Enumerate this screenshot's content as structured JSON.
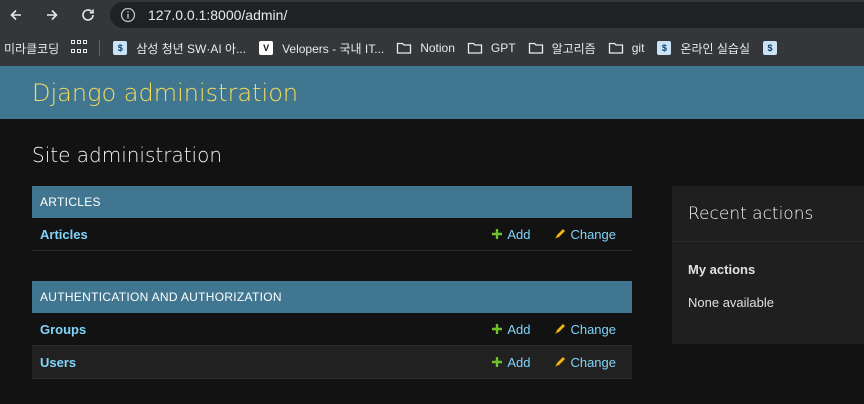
{
  "browser": {
    "url": "127.0.0.1:8000/admin/",
    "bookmarks": [
      {
        "label": "미라클코딩",
        "icon": "none"
      },
      {
        "label": "",
        "icon": "apps-grid-icon"
      },
      {
        "label": "삼성 청년 SW·AI 아...",
        "icon": "ssafy-favicon"
      },
      {
        "label": "Velopers - 국내 IT...",
        "icon": "velopers-favicon"
      },
      {
        "label": "Notion",
        "icon": "folder-icon"
      },
      {
        "label": "GPT",
        "icon": "folder-icon"
      },
      {
        "label": "알고리즘",
        "icon": "folder-icon"
      },
      {
        "label": "git",
        "icon": "folder-icon"
      },
      {
        "label": "온라인 실습실",
        "icon": "ssafy-favicon"
      }
    ]
  },
  "header": {
    "brand": "Django administration"
  },
  "page": {
    "title": "Site administration"
  },
  "modules": [
    {
      "caption": "ARTICLES",
      "models": [
        {
          "name": "Articles",
          "add_label": "Add",
          "change_label": "Change"
        }
      ]
    },
    {
      "caption": "AUTHENTICATION AND AUTHORIZATION",
      "models": [
        {
          "name": "Groups",
          "add_label": "Add",
          "change_label": "Change"
        },
        {
          "name": "Users",
          "add_label": "Add",
          "change_label": "Change"
        }
      ]
    }
  ],
  "recent_actions": {
    "title": "Recent actions",
    "subtitle": "My actions",
    "empty_text": "None available"
  },
  "colors": {
    "header_bg": "#417690",
    "brand": "#f5dd5d",
    "link": "#81d4fa",
    "add_icon": "#70bf2b",
    "change_icon": "#efb80b",
    "background": "#121212"
  }
}
